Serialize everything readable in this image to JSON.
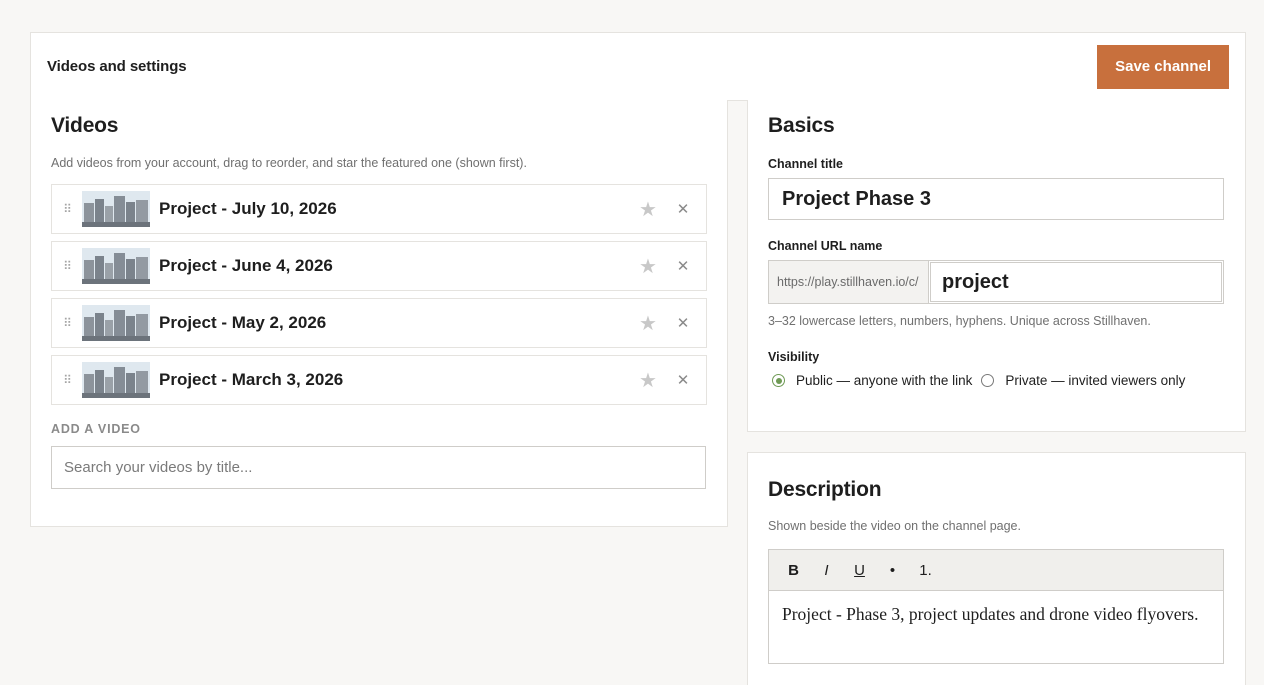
{
  "header": {
    "title": "Videos and settings",
    "save_label": "Save channel"
  },
  "videos": {
    "title": "Videos",
    "hint": "Add videos from your account, drag to reorder, and star the featured one (shown first).",
    "items": [
      {
        "title": "Project - July 10, 2026"
      },
      {
        "title": "Project - June 4, 2026"
      },
      {
        "title": "Project - May 2, 2026"
      },
      {
        "title": "Project - March 3, 2026"
      }
    ],
    "add_label": "ADD A VIDEO",
    "search_placeholder": "Search your videos by title..."
  },
  "basics": {
    "title": "Basics",
    "channel_title_label": "Channel title",
    "channel_title_value": "Project Phase 3",
    "url_label": "Channel URL name",
    "url_prefix": "https://play.stillhaven.io/c/",
    "url_value": "project",
    "url_hint": "3–32 lowercase letters, numbers, hyphens. Unique across Stillhaven.",
    "visibility_label": "Visibility",
    "visibility_options": [
      {
        "label": "Public — anyone with the link",
        "selected": true
      },
      {
        "label": "Private — invited viewers only",
        "selected": false
      }
    ]
  },
  "description": {
    "title": "Description",
    "hint": "Shown beside the video on the channel page.",
    "toolbar": {
      "bold": "B",
      "italic": "I",
      "underline": "U",
      "bullet": "•",
      "numbered": "1."
    },
    "body": "Project - Phase 3, project updates and drone video flyovers."
  },
  "colors": {
    "accent": "#c8703d",
    "radio_selected": "#6f9a55",
    "page_bg": "#f8f7f5"
  }
}
